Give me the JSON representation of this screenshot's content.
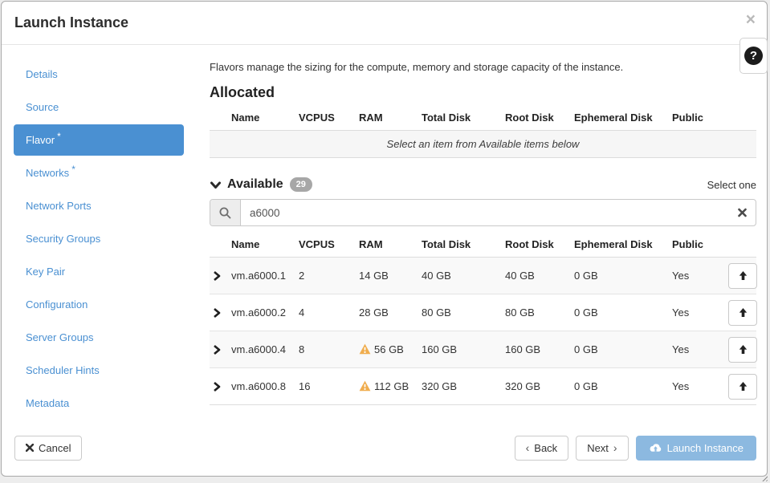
{
  "modal": {
    "title": "Launch Instance",
    "close_icon": "×",
    "help_icon": "?"
  },
  "sidebar": {
    "items": [
      {
        "label": "Details",
        "required": false,
        "selected": false
      },
      {
        "label": "Source",
        "required": false,
        "selected": false
      },
      {
        "label": "Flavor",
        "required": true,
        "selected": true
      },
      {
        "label": "Networks",
        "required": true,
        "selected": false
      },
      {
        "label": "Network Ports",
        "required": false,
        "selected": false
      },
      {
        "label": "Security Groups",
        "required": false,
        "selected": false
      },
      {
        "label": "Key Pair",
        "required": false,
        "selected": false
      },
      {
        "label": "Configuration",
        "required": false,
        "selected": false
      },
      {
        "label": "Server Groups",
        "required": false,
        "selected": false
      },
      {
        "label": "Scheduler Hints",
        "required": false,
        "selected": false
      },
      {
        "label": "Metadata",
        "required": false,
        "selected": false
      }
    ],
    "required_marker": "*"
  },
  "main": {
    "description": "Flavors manage the sizing for the compute, memory and storage capacity of the instance.",
    "allocated": {
      "title": "Allocated",
      "columns": [
        "Name",
        "VCPUS",
        "RAM",
        "Total Disk",
        "Root Disk",
        "Ephemeral Disk",
        "Public"
      ],
      "empty_message": "Select an item from Available items below"
    },
    "available": {
      "title": "Available",
      "count": "29",
      "select_hint": "Select one",
      "search_value": "a6000",
      "columns": [
        "Name",
        "VCPUS",
        "RAM",
        "Total Disk",
        "Root Disk",
        "Ephemeral Disk",
        "Public"
      ],
      "rows": [
        {
          "name": "vm.a6000.1",
          "vcpus": "2",
          "ram": "14 GB",
          "ram_warning": false,
          "total_disk": "40 GB",
          "root_disk": "40 GB",
          "ephemeral_disk": "0 GB",
          "public": "Yes"
        },
        {
          "name": "vm.a6000.2",
          "vcpus": "4",
          "ram": "28 GB",
          "ram_warning": false,
          "total_disk": "80 GB",
          "root_disk": "80 GB",
          "ephemeral_disk": "0 GB",
          "public": "Yes"
        },
        {
          "name": "vm.a6000.4",
          "vcpus": "8",
          "ram": "56 GB",
          "ram_warning": true,
          "total_disk": "160 GB",
          "root_disk": "160 GB",
          "ephemeral_disk": "0 GB",
          "public": "Yes"
        },
        {
          "name": "vm.a6000.8",
          "vcpus": "16",
          "ram": "112 GB",
          "ram_warning": true,
          "total_disk": "320 GB",
          "root_disk": "320 GB",
          "ephemeral_disk": "0 GB",
          "public": "Yes"
        }
      ]
    }
  },
  "footer": {
    "cancel_label": "Cancel",
    "back_label": "Back",
    "next_label": "Next",
    "launch_label": "Launch Instance",
    "back_icon": "‹",
    "next_icon": "›"
  },
  "colors": {
    "accent": "#4a90d2",
    "warning": "#f0ad4e",
    "launch_disabled": "#8cb9e0",
    "badge": "#a7a7a7"
  }
}
